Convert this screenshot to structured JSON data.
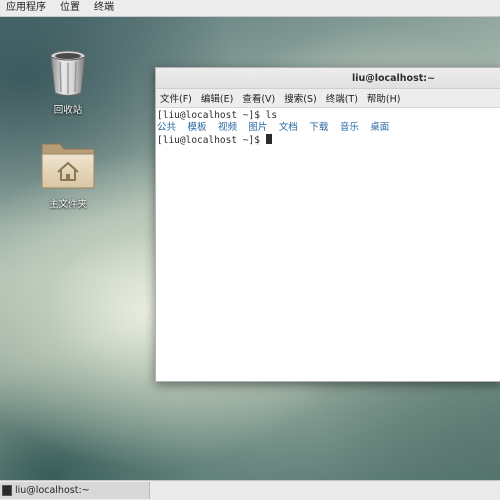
{
  "top_panel": {
    "menus": [
      "应用程序",
      "位置",
      "终端"
    ]
  },
  "desktop": {
    "icons": [
      {
        "label": "回收站",
        "icon": "trash-icon"
      },
      {
        "label": "主文件夹",
        "icon": "home-folder-icon"
      }
    ]
  },
  "terminal": {
    "title": "liu@localhost:~",
    "menu": [
      "文件(F)",
      "编辑(E)",
      "查看(V)",
      "搜索(S)",
      "终端(T)",
      "帮助(H)"
    ],
    "lines": [
      {
        "prompt": "[liu@localhost ~]$ ",
        "command": "ls"
      },
      {
        "prompt": "[liu@localhost ~]$ ",
        "command": ""
      }
    ],
    "ls_output": [
      "公共",
      "模板",
      "视频",
      "图片",
      "文档",
      "下载",
      "音乐",
      "桌面"
    ]
  },
  "taskbar": {
    "items": [
      {
        "label": "liu@localhost:~",
        "icon": "terminal-icon"
      }
    ]
  },
  "colors": {
    "directory": "#2a6aa3",
    "panel": "#ececec"
  }
}
